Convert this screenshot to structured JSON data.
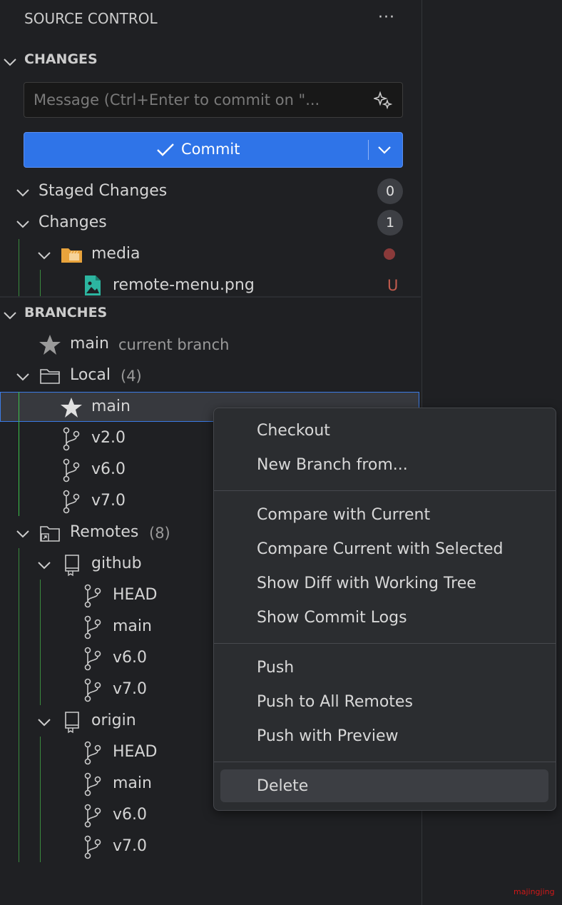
{
  "panel": {
    "title": "SOURCE CONTROL",
    "more_label": "···"
  },
  "changes": {
    "header": "CHANGES",
    "message_placeholder": "Message (Ctrl+Enter to commit on \"...",
    "commit_label": "Commit",
    "staged": {
      "label": "Staged Changes",
      "count": "0"
    },
    "changes": {
      "label": "Changes",
      "count": "1"
    },
    "folder": {
      "name": "media",
      "status_color": "#8a3a3a"
    },
    "file": {
      "name": "remote-menu.png",
      "status": "U"
    }
  },
  "branches": {
    "header": "BRANCHES",
    "current": {
      "name": "main",
      "note": "current branch"
    },
    "local": {
      "label": "Local",
      "count": "(4)",
      "items": [
        "main",
        "v2.0",
        "v6.0",
        "v7.0"
      ]
    },
    "remotes": {
      "label": "Remotes",
      "count": "(8)",
      "github": {
        "name": "github",
        "items": [
          "HEAD",
          "main",
          "v6.0",
          "v7.0"
        ]
      },
      "origin": {
        "name": "origin",
        "items": [
          "HEAD",
          "main",
          "v6.0",
          "v7.0"
        ]
      }
    }
  },
  "context_menu": {
    "items": [
      "Checkout",
      "New Branch from...",
      "Compare with Current",
      "Compare Current with Selected",
      "Show Diff with Working Tree",
      "Show Commit Logs",
      "Push",
      "Push to All Remotes",
      "Push with Preview",
      "Delete"
    ]
  },
  "watermark": "majingjing",
  "colors": {
    "accent": "#2f74e8",
    "untracked": "#c25b4e",
    "guide_green": "#3cc14a",
    "folder_orange": "#e8a33c",
    "file_teal": "#2cb5a0"
  }
}
